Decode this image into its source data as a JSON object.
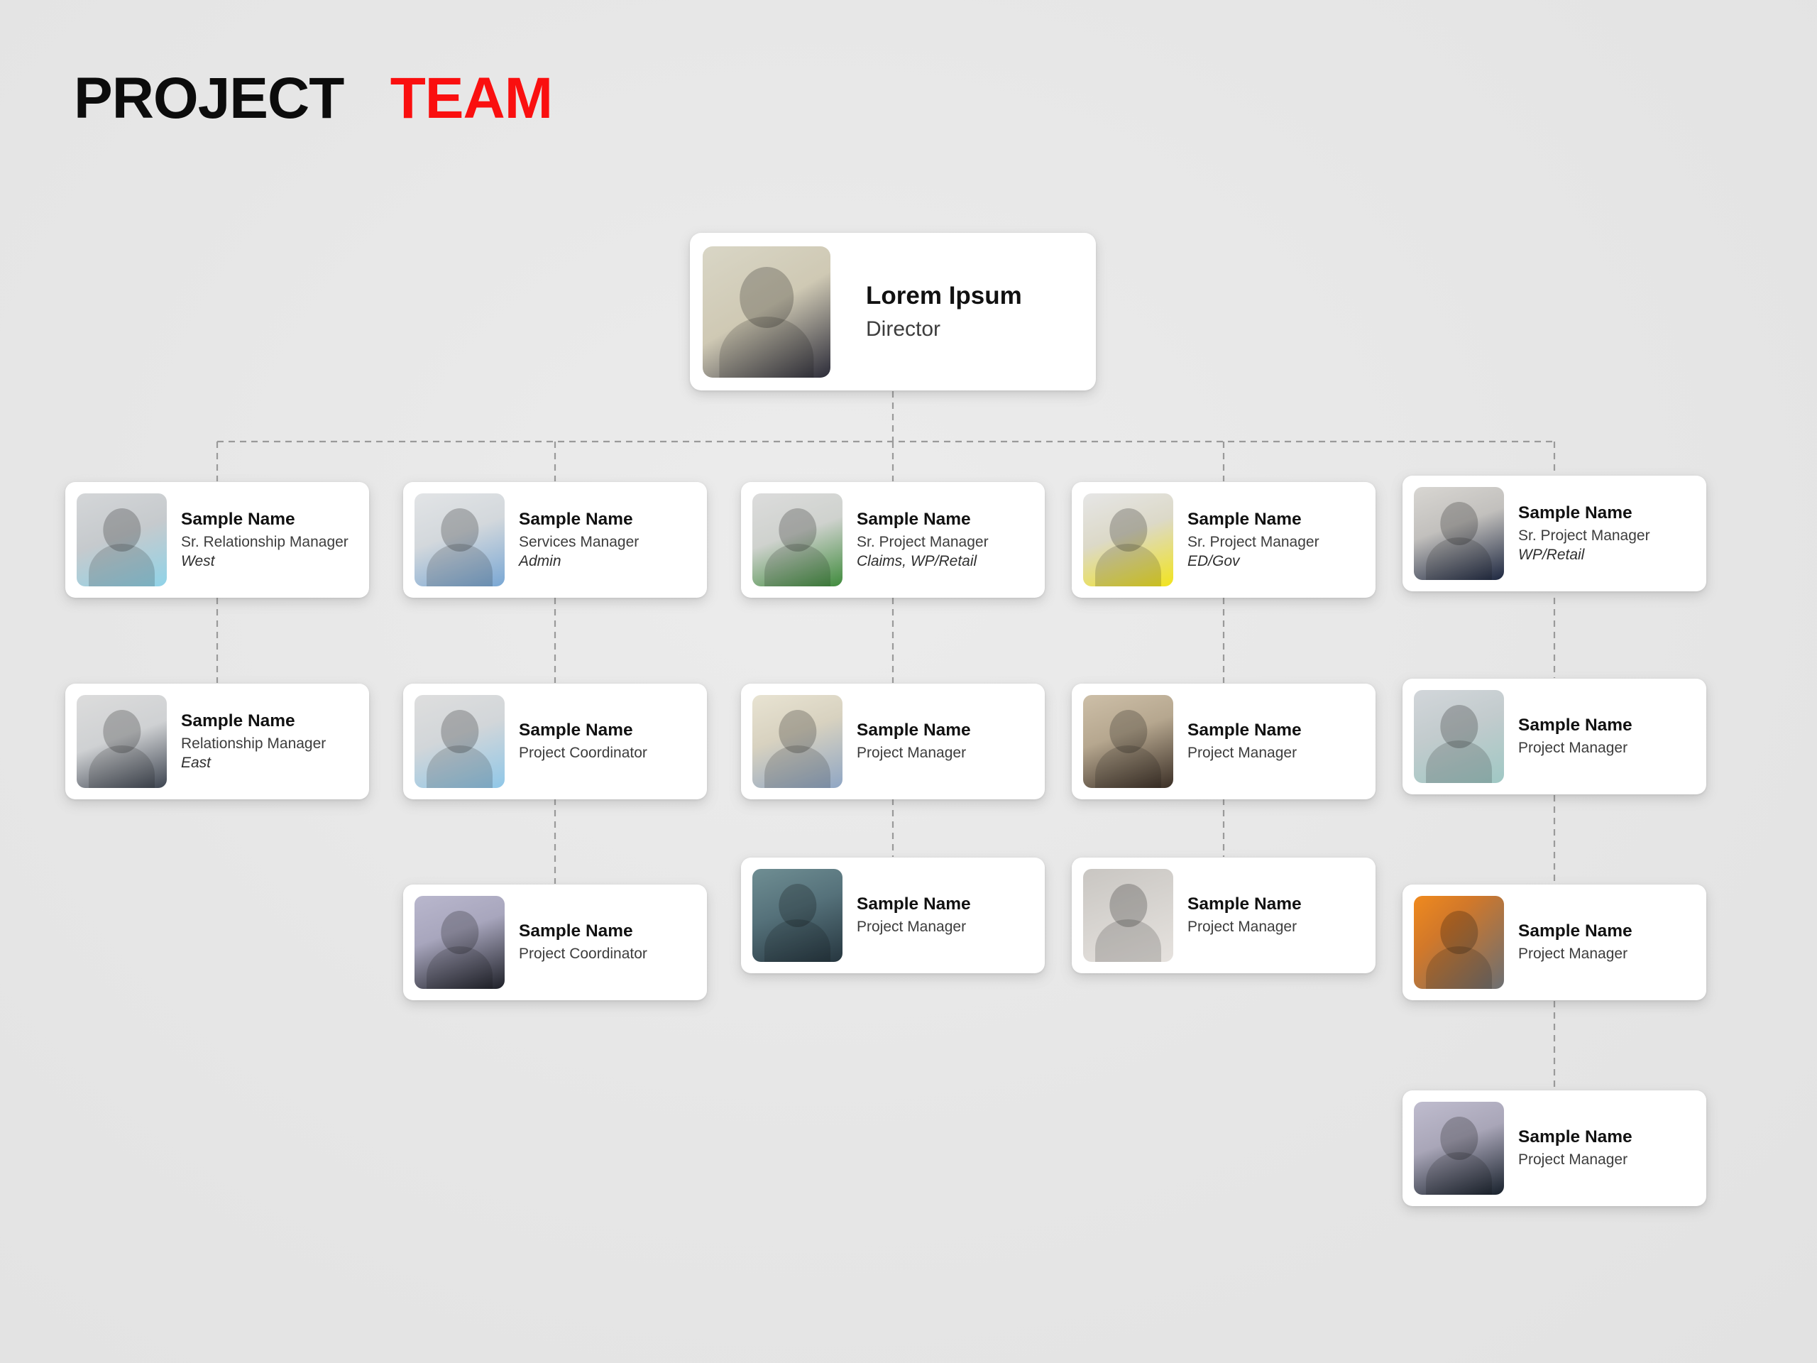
{
  "title": {
    "part1": "PROJECT",
    "part2": "TEAM",
    "color_part1": "#0c0c0c",
    "color_part2": "#fa0f0f"
  },
  "canvas": {
    "background": "#e8e8e8",
    "connector_color": "#9a9a9a",
    "connector_style": "dashed"
  },
  "chart_data": {
    "type": "org-chart",
    "title": "PROJECT TEAM",
    "root": {
      "id": "root",
      "name": "Lorem Ipsum",
      "role": "Director",
      "unit": "",
      "photo_name": "director-headshot",
      "photo_colors": [
        "#d9d6c6",
        "#2b2b38"
      ]
    },
    "columns": [
      {
        "column_index": 1,
        "nodes": [
          {
            "id": "c1r1",
            "name": "Sample Name",
            "role": "Sr. Relationship Manager",
            "unit": "West",
            "photo_name": "blonde-woman-headshot",
            "photo_colors": [
              "#d4d6d8",
              "#8fd3e8"
            ]
          },
          {
            "id": "c1r2",
            "name": "Sample Name",
            "role": "Relationship Manager",
            "unit": "East",
            "photo_name": "grey-haired-man-headshot",
            "photo_colors": [
              "#dcdcdc",
              "#3d4450"
            ]
          }
        ]
      },
      {
        "column_index": 2,
        "nodes": [
          {
            "id": "c2r1",
            "name": "Sample Name",
            "role": "Services Manager",
            "unit": "Admin",
            "photo_name": "man-blue-shirt-headshot",
            "photo_colors": [
              "#e2e4e6",
              "#79a7d4"
            ]
          },
          {
            "id": "c2r2",
            "name": "Sample Name",
            "role": "Project Coordinator",
            "unit": "",
            "photo_name": "man-striped-shirt-headshot",
            "photo_colors": [
              "#dedede",
              "#8fc7e8"
            ]
          },
          {
            "id": "c2r3",
            "name": "Sample Name",
            "role": "Project Coordinator",
            "unit": "",
            "photo_name": "bearded-man-dark-shirt-headshot",
            "photo_colors": [
              "#b9b7cd",
              "#1e2028"
            ]
          }
        ]
      },
      {
        "column_index": 3,
        "nodes": [
          {
            "id": "c3r1",
            "name": "Sample Name",
            "role": "Sr. Project Manager",
            "unit": "Claims,  WP/Retail",
            "photo_name": "man-green-polo-headshot",
            "photo_colors": [
              "#dcdcdc",
              "#3f8b3c"
            ]
          },
          {
            "id": "c3r2",
            "name": "Sample Name",
            "role": "Project Manager",
            "unit": "",
            "photo_name": "woman-glasses-denim-headshot",
            "photo_colors": [
              "#e8e3d2",
              "#8fa6c4"
            ]
          },
          {
            "id": "c3r3",
            "name": "Sample Name",
            "role": "Project Manager",
            "unit": "",
            "photo_name": "young-man-suspenders-headshot",
            "photo_colors": [
              "#6f8e93",
              "#26363f"
            ]
          }
        ]
      },
      {
        "column_index": 4,
        "nodes": [
          {
            "id": "c4r1",
            "name": "Sample Name",
            "role": "Sr. Project Manager",
            "unit": "ED/Gov",
            "photo_name": "woman-yellow-top-headshot",
            "photo_colors": [
              "#e6e6e6",
              "#f2e41c"
            ]
          },
          {
            "id": "c4r2",
            "name": "Sample Name",
            "role": "Project Manager",
            "unit": "",
            "photo_name": "man-tie-glasses-headshot",
            "photo_colors": [
              "#cdbfa8",
              "#3b2f26"
            ]
          },
          {
            "id": "c4r3",
            "name": "Sample Name",
            "role": "Project Manager",
            "unit": "",
            "photo_name": "woman-white-blouse-headshot",
            "photo_colors": [
              "#c9c6c2",
              "#e6e2de"
            ]
          }
        ]
      },
      {
        "column_index": 5,
        "nodes": [
          {
            "id": "c5r1",
            "name": "Sample Name",
            "role": "Sr. Project Manager",
            "unit": "WP/Retail",
            "photo_name": "man-navy-suit-headshot",
            "photo_colors": [
              "#d8d6d2",
              "#1d2740"
            ]
          },
          {
            "id": "c5r2",
            "name": "Sample Name",
            "role": "Project Manager",
            "unit": "",
            "photo_name": "curly-hair-man-floral-shirt-headshot",
            "photo_colors": [
              "#d2d6da",
              "#9fc8c4"
            ]
          },
          {
            "id": "c5r3",
            "name": "Sample Name",
            "role": "Project Manager",
            "unit": "",
            "photo_name": "woman-grey-blazer-orange-bg-headshot",
            "photo_colors": [
              "#f08a1e",
              "#6b6f73"
            ]
          },
          {
            "id": "c5r4",
            "name": "Sample Name",
            "role": "Project Manager",
            "unit": "",
            "photo_name": "blonde-woman-black-top-headshot",
            "photo_colors": [
              "#bfbcce",
              "#17202b"
            ]
          }
        ]
      }
    ]
  }
}
